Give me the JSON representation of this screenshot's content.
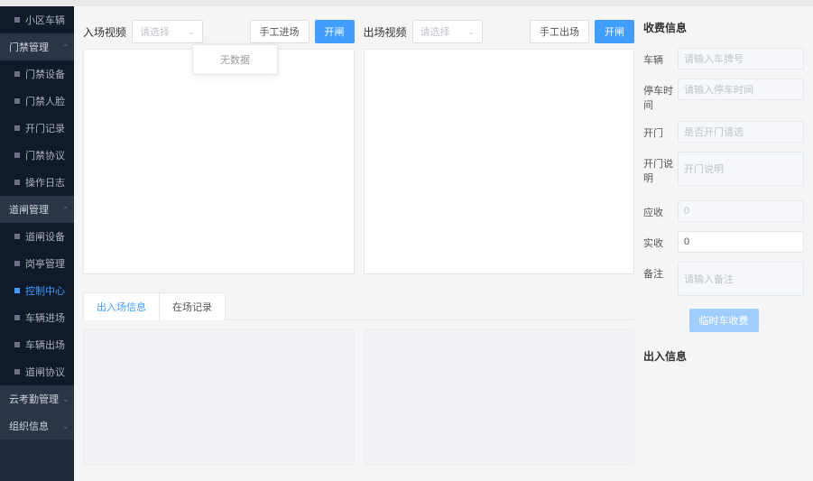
{
  "sidebar": {
    "items": [
      {
        "label": "小区车辆",
        "type": "child"
      },
      {
        "label": "门禁管理",
        "type": "parent"
      },
      {
        "label": "门禁设备",
        "type": "child"
      },
      {
        "label": "门禁人脸",
        "type": "child"
      },
      {
        "label": "开门记录",
        "type": "child"
      },
      {
        "label": "门禁协议",
        "type": "child"
      },
      {
        "label": "操作日志",
        "type": "child"
      },
      {
        "label": "道闸管理",
        "type": "parent"
      },
      {
        "label": "道闸设备",
        "type": "child"
      },
      {
        "label": "岗亭管理",
        "type": "child"
      },
      {
        "label": "控制中心",
        "type": "child",
        "active": true
      },
      {
        "label": "车辆进场",
        "type": "child"
      },
      {
        "label": "车辆出场",
        "type": "child"
      },
      {
        "label": "道闸协议",
        "type": "child"
      },
      {
        "label": "云考勤管理",
        "type": "parent"
      },
      {
        "label": "组织信息",
        "type": "parent"
      }
    ]
  },
  "video": {
    "in_label": "入场视频",
    "in_select_placeholder": "请选择",
    "in_manual_btn": "手工进场",
    "in_open_btn": "开闸",
    "out_label": "出场视频",
    "out_select_placeholder": "请选择",
    "out_manual_btn": "手工出场",
    "out_open_btn": "开闸",
    "dropdown_empty": "无数据"
  },
  "tabs": {
    "in_out": "出入场信息",
    "present": "在场记录"
  },
  "right": {
    "fee_title": "收费信息",
    "fields": {
      "car_label": "车辆",
      "car_ph": "请输入车牌号",
      "park_time_label": "停车时间",
      "park_time_ph": "请输入停车时间",
      "open_label": "开门",
      "open_ph": "是否开门请选",
      "open_note_label": "开门说明",
      "open_note_ph": "开门说明",
      "should_label": "应收",
      "should_val": "0",
      "actual_label": "实收",
      "actual_val": "0",
      "remark_label": "备注",
      "remark_ph": "请输入备注"
    },
    "submit_btn": "临时车收费",
    "inout_title": "出入信息"
  }
}
